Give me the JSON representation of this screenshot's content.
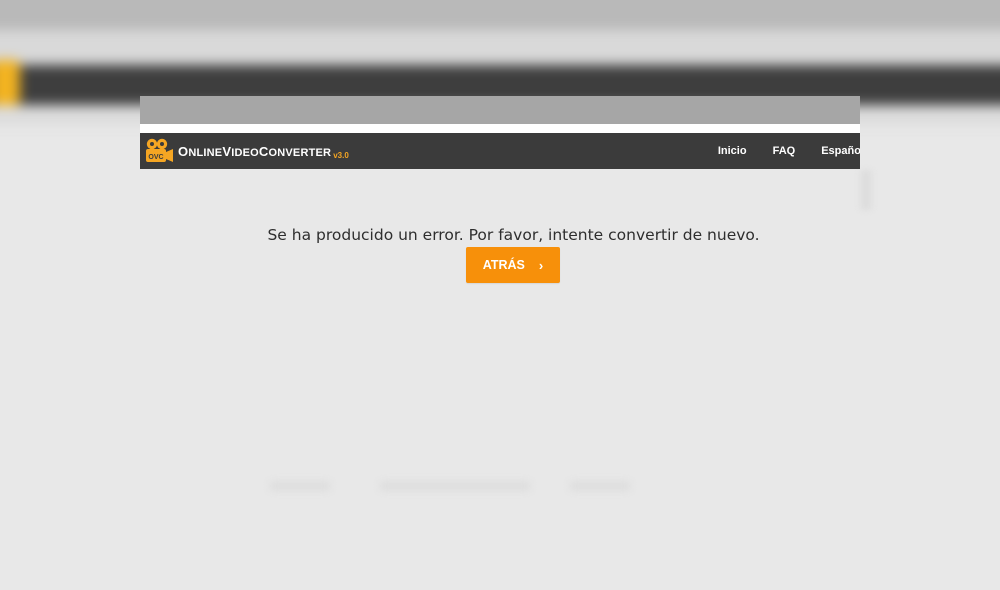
{
  "site": {
    "logo_name_part1": "Online",
    "logo_name_part2": "Video",
    "logo_name_part3": "Converter",
    "logo_version": "v3.0",
    "logo_icon_text": "OVC",
    "logo_icon": "film-camera-icon"
  },
  "nav": {
    "items": [
      {
        "label": "Inicio"
      },
      {
        "label": "FAQ"
      },
      {
        "label": "Español"
      }
    ]
  },
  "main": {
    "error_message": "Se ha producido un error. Por favor, intente convertir de nuevo.",
    "back_button_label": "ATRÁS",
    "back_button_icon": "chevron-right-icon"
  },
  "colors": {
    "header_bg": "#3b3b3b",
    "accent": "#f7900a",
    "logo_yellow": "#f5a623",
    "page_bg": "#e8e8e8"
  }
}
